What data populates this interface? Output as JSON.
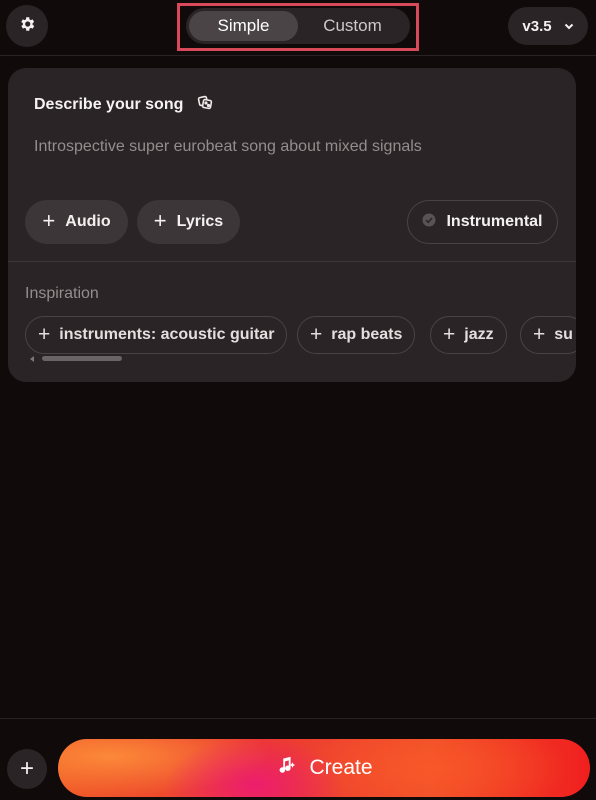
{
  "header": {
    "settings_icon": "gear-icon",
    "mode_tabs": [
      {
        "label": "Simple",
        "active": true
      },
      {
        "label": "Custom",
        "active": false
      }
    ],
    "version": "v3.5",
    "version_icon": "chevron-down-icon",
    "highlight_color": "#d84a5a"
  },
  "card": {
    "title": "Describe your song",
    "title_icon": "dice-icon",
    "prompt_value": "Introspective super eurobeat song about mixed signals",
    "buttons": {
      "audio": "Audio",
      "lyrics": "Lyrics",
      "instrumental": "Instrumental"
    },
    "inspiration": {
      "label": "Inspiration",
      "chips": [
        "instruments: acoustic guitar",
        "rap beats",
        "jazz",
        "su"
      ]
    }
  },
  "footer": {
    "add_icon": "plus-icon",
    "create_label": "Create",
    "create_icon": "music-sparkle-icon"
  },
  "colors": {
    "background": "#110a0b",
    "card": "#2a2426",
    "create_gradient_start": "#f05a28",
    "create_gradient_end": "#f01f1f"
  }
}
